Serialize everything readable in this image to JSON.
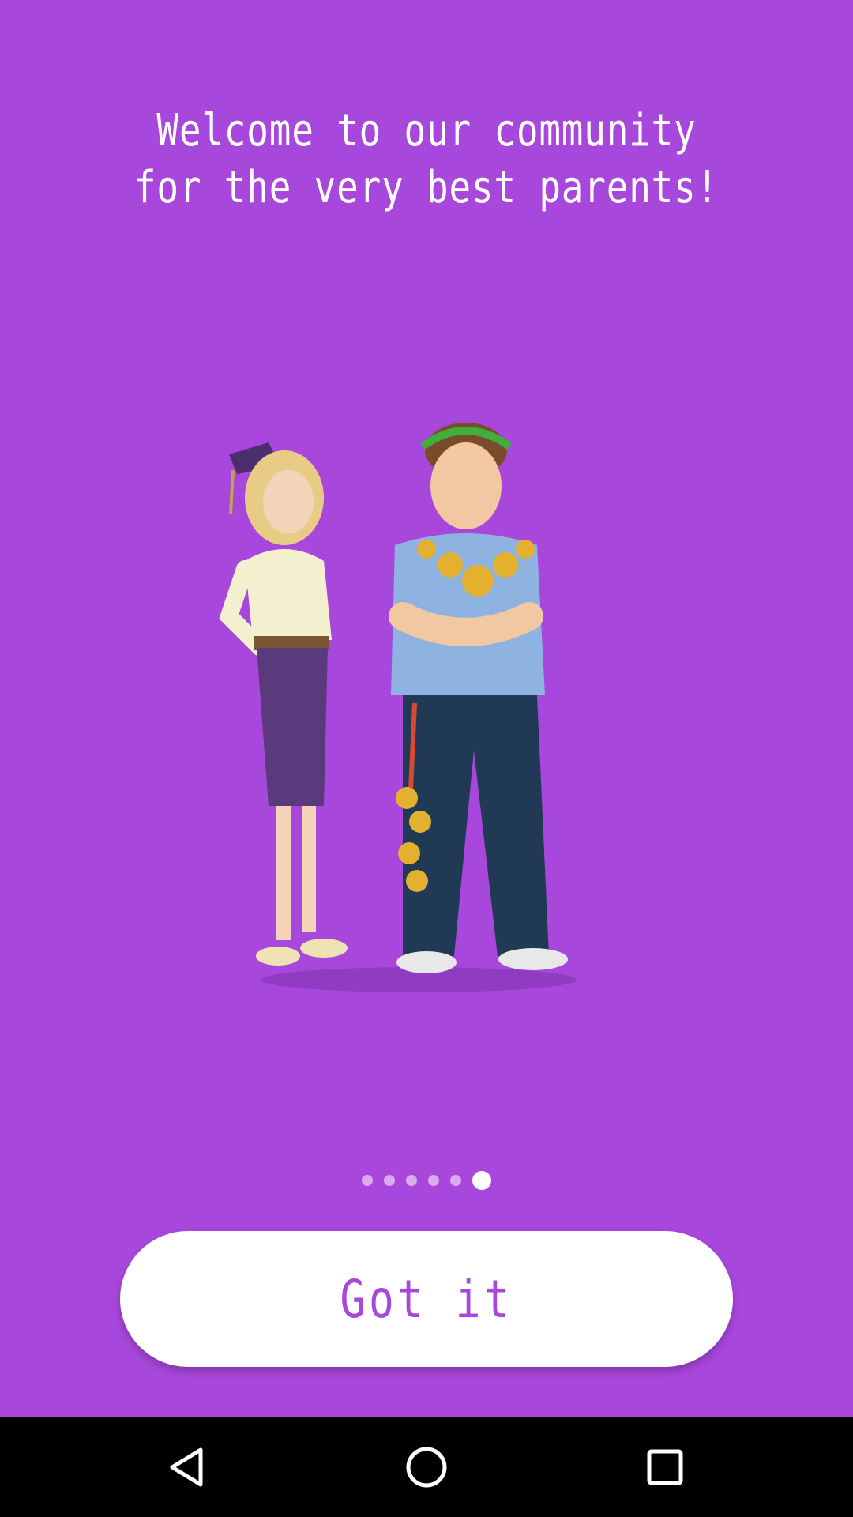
{
  "onboarding": {
    "headline": "Welcome to our community for the very best parents!",
    "illustration_icon": "parents-couple-illustration",
    "pager": {
      "total": 6,
      "active_index": 5
    },
    "button_label": "Got it"
  },
  "navbar": {
    "back_icon": "back-triangle-icon",
    "home_icon": "home-circle-icon",
    "recents_icon": "recents-square-icon"
  },
  "colors": {
    "background": "#a847dc",
    "button": "#ffffff",
    "button_text": "#a847dc",
    "navbar": "#000000"
  }
}
